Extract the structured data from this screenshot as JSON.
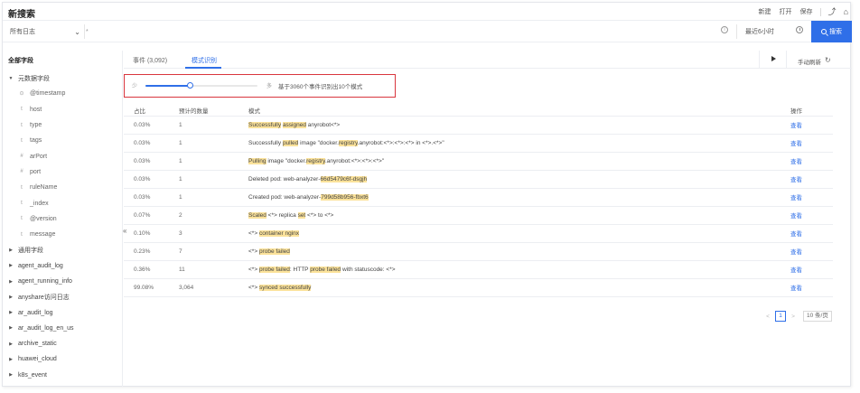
{
  "app": {
    "title": "新搜索"
  },
  "top_actions": {
    "new": "新建",
    "open": "打开",
    "save": "保存",
    "share_icon": "share-icon",
    "home_icon": "home-icon"
  },
  "search": {
    "logset": "所有日志",
    "query": "*",
    "time_range": "最近6小时",
    "button": "搜索"
  },
  "sidebar": {
    "header": "全部字段",
    "items": [
      {
        "kind": "group",
        "caret": "▼",
        "name": "元数据字段"
      },
      {
        "kind": "field",
        "type": "⊙",
        "name": "@timestamp"
      },
      {
        "kind": "field",
        "type": "t",
        "name": "host"
      },
      {
        "kind": "field",
        "type": "t",
        "name": "type"
      },
      {
        "kind": "field",
        "type": "t",
        "name": "tags"
      },
      {
        "kind": "field",
        "type": "#",
        "name": "arPort"
      },
      {
        "kind": "field",
        "type": "#",
        "name": "port"
      },
      {
        "kind": "field",
        "type": "t",
        "name": "ruleName"
      },
      {
        "kind": "field",
        "type": "t",
        "name": "_index"
      },
      {
        "kind": "field",
        "type": "t",
        "name": "@version"
      },
      {
        "kind": "field",
        "type": "t",
        "name": "message"
      },
      {
        "kind": "group",
        "caret": "▶",
        "name": "通用字段"
      },
      {
        "kind": "group",
        "caret": "▶",
        "name": "agent_audit_log"
      },
      {
        "kind": "group",
        "caret": "▶",
        "name": "agent_running_info"
      },
      {
        "kind": "group",
        "caret": "▶",
        "name": "anyshare访问日志"
      },
      {
        "kind": "group",
        "caret": "▶",
        "name": "ar_audit_log"
      },
      {
        "kind": "group",
        "caret": "▶",
        "name": "ar_audit_log_en_us"
      },
      {
        "kind": "group",
        "caret": "▶",
        "name": "archive_static"
      },
      {
        "kind": "group",
        "caret": "▶",
        "name": "huawei_cloud"
      },
      {
        "kind": "group",
        "caret": "▶",
        "name": "k8s_event"
      }
    ]
  },
  "tabs": {
    "events": "事件 (3,092)",
    "patterns": "模式识别"
  },
  "toolbar": {
    "manual_refresh": "手动刷新"
  },
  "pattern_slider": {
    "min": "少",
    "max": "多",
    "summary": "基于3060个事件识别出10个模式",
    "level": 0.4
  },
  "table": {
    "headers": [
      "占比",
      "预计的数量",
      "模式",
      "操作"
    ],
    "rows": [
      {
        "pct": "0.03%",
        "count": "1",
        "op": "查看",
        "pattern": [
          {
            "t": "Successfully",
            "h": true
          },
          {
            "t": " "
          },
          {
            "t": "assigned",
            "h": true
          },
          {
            "t": " anyrobot<*>"
          }
        ]
      },
      {
        "pct": "0.03%",
        "count": "1",
        "op": "查看",
        "pattern": [
          {
            "t": "Successfully "
          },
          {
            "t": "pulled",
            "h": true
          },
          {
            "t": " image \"docker."
          },
          {
            "t": "registry",
            "h": true
          },
          {
            "t": ".anyrobot:<*>:<*>:<*> in <*>.<*>\""
          }
        ]
      },
      {
        "pct": "0.03%",
        "count": "1",
        "op": "查看",
        "pattern": [
          {
            "t": "Pulling",
            "h": true
          },
          {
            "t": " image \"docker."
          },
          {
            "t": "registry",
            "h": true
          },
          {
            "t": ".anyrobot:<*>:<*>:<*>\""
          }
        ]
      },
      {
        "pct": "0.03%",
        "count": "1",
        "op": "查看",
        "pattern": [
          {
            "t": "Deleted pod: web-analyzer-"
          },
          {
            "t": "66d5479c6f-dsgjh",
            "h": true
          }
        ]
      },
      {
        "pct": "0.03%",
        "count": "1",
        "op": "查看",
        "pattern": [
          {
            "t": "Created pod: web-analyzer-"
          },
          {
            "t": "799d58b956-fbxt6",
            "h": true
          }
        ]
      },
      {
        "pct": "0.07%",
        "count": "2",
        "op": "查看",
        "pattern": [
          {
            "t": "Scaled",
            "h": true
          },
          {
            "t": " <*> replica "
          },
          {
            "t": "set",
            "h": true
          },
          {
            "t": " <*> to <*>"
          }
        ]
      },
      {
        "pct": "0.10%",
        "count": "3",
        "op": "查看",
        "pattern": [
          {
            "t": "<*> "
          },
          {
            "t": "container nginx",
            "h": true
          }
        ]
      },
      {
        "pct": "0.23%",
        "count": "7",
        "op": "查看",
        "pattern": [
          {
            "t": "<*> "
          },
          {
            "t": "probe failed",
            "h": true
          }
        ]
      },
      {
        "pct": "0.36%",
        "count": "11",
        "op": "查看",
        "pattern": [
          {
            "t": "<*> "
          },
          {
            "t": "probe failed",
            "h": true
          },
          {
            "t": ": HTTP "
          },
          {
            "t": "probe failed",
            "h": true
          },
          {
            "t": " with statuscode: <*>"
          }
        ]
      },
      {
        "pct": "99.08%",
        "count": "3,064",
        "op": "查看",
        "pattern": [
          {
            "t": "<*> "
          },
          {
            "t": "synced successfully",
            "h": true
          }
        ]
      }
    ]
  },
  "pagination": {
    "prev": "<",
    "page": "1",
    "next": ">",
    "page_size": "10 条/页"
  },
  "colors": {
    "accent": "#2f6fe8",
    "highlight": "#fbe29a",
    "annotation_box": "#d9363e"
  }
}
